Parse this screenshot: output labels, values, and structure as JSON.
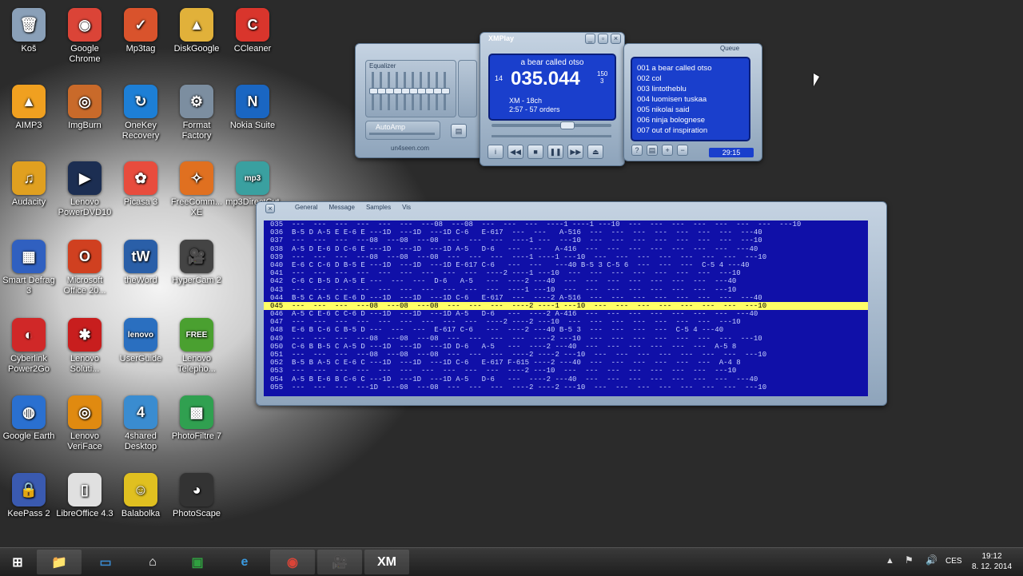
{
  "desktop": {
    "icons": [
      {
        "label": "Koš",
        "glyph": "🗑",
        "color": "#8aa0b8"
      },
      {
        "label": "Google Chrome",
        "glyph": "◉",
        "color": "#db4437"
      },
      {
        "label": "Mp3tag",
        "glyph": "✓",
        "color": "#d9532c"
      },
      {
        "label": "DiskGoogle",
        "glyph": "▲",
        "color": "#e1b13a"
      },
      {
        "label": "CCleaner",
        "glyph": "C",
        "color": "#d9352c"
      },
      {
        "label": "AIMP3",
        "glyph": "▲",
        "color": "#f0a020"
      },
      {
        "label": "ImgBurn",
        "glyph": "◎",
        "color": "#c96a2a"
      },
      {
        "label": "OneKey Recovery",
        "glyph": "↻",
        "color": "#1d7fd6"
      },
      {
        "label": "Format Factory",
        "glyph": "⚙",
        "color": "#7c8ea0"
      },
      {
        "label": "Nokia Suite",
        "glyph": "N",
        "color": "#1a66c2"
      },
      {
        "label": "Audacity",
        "glyph": "♫",
        "color": "#e0a020"
      },
      {
        "label": "Lenovo PowerDVD10",
        "glyph": "▶",
        "color": "#1c2e52"
      },
      {
        "label": "Picasa 3",
        "glyph": "✿",
        "color": "#e84c3d"
      },
      {
        "label": "FreeComm... XE",
        "glyph": "✧",
        "color": "#e07020"
      },
      {
        "label": "mp3DirectCut",
        "glyph": "mp3",
        "color": "#3aa0a0"
      },
      {
        "label": "Smart Defrag 3",
        "glyph": "▦",
        "color": "#3060c0"
      },
      {
        "label": "Microsoft Office 20...",
        "glyph": "O",
        "color": "#d04020"
      },
      {
        "label": "theWord",
        "glyph": "tW",
        "color": "#2a5fa8"
      },
      {
        "label": "HyperCam 2",
        "glyph": "🎥",
        "color": "#444444"
      },
      {
        "label": "Cyberlink Power2Go",
        "glyph": "◐",
        "color": "#d02828"
      },
      {
        "label": "Lenovo Soluti...",
        "glyph": "✱",
        "color": "#c81e1e"
      },
      {
        "label": "UserGuide",
        "glyph": "lenovo",
        "color": "#2a6fc0"
      },
      {
        "label": "Lenovo Telepho...",
        "glyph": "FREE",
        "color": "#4aa030"
      },
      {
        "label": "Google Earth",
        "glyph": "◍",
        "color": "#2a70d0"
      },
      {
        "label": "Lenovo VeriFace",
        "glyph": "◎",
        "color": "#e08a10"
      },
      {
        "label": "4shared Desktop",
        "glyph": "4",
        "color": "#3a8cd0"
      },
      {
        "label": "PhotoFiltre 7",
        "glyph": "▩",
        "color": "#30a050"
      },
      {
        "label": "KeePass 2",
        "glyph": "🔒",
        "color": "#3a5ab0"
      },
      {
        "label": "LibreOffice 4.3",
        "glyph": "▯",
        "color": "#e0e0e0"
      },
      {
        "label": "Balabolka",
        "glyph": "☺",
        "color": "#e0c020"
      },
      {
        "label": "PhotoScape",
        "glyph": "◕",
        "color": "#333333"
      }
    ]
  },
  "xmplay": {
    "equalizer_label": "Equalizer",
    "autoamp_label": "AutoAmp",
    "site": "un4seen.com",
    "title_bar": "XMPlay",
    "track_title": "a bear called otso",
    "left_num": "14",
    "time": "035.044",
    "right_top": "150",
    "right_bottom": "3",
    "format": "XM - 18ch",
    "duration": "2:57 - 57 orders",
    "queue_label": "Queue",
    "queue_total": "29:15",
    "queue": [
      "001 a bear called otso",
      "002 col",
      "003 lintotheblu",
      "004 luomisen tuskaa",
      "005 nikolai said",
      "006 ninja bolognese",
      "007 out of inspiration"
    ],
    "tabs": [
      "General",
      "Message",
      "Samples",
      "Vis"
    ],
    "pattern_rows": [
      "035  ---  ---  ---  ---  ---  ---  ---08  ---08  ---  ---  ---  ----1 ----1 ---10  ---  ---  ---  ---  ---  ---  ---  ---10",
      "036  B-5 D A-5 E E-6 E ---1D  ---1D  ---1D C-6   E-617  ---  ---   A-516  ---  ---  ---  ---  ---  ---  ---  ---40",
      "037  ---  ---  ---  ---08  ---08  ---08  ---  ---  ---  ----1 ---  ---10  ---  ---  ---  ---  ---  ---  ---  ---10",
      "038  A-5 D E-6 D C-6 E ---1D  ---1D  ---1D A-5   D-6   ---  ---   A-416  ---  ---  ---  ---  ---  ---  ---  ---40",
      "039  ---  ---  ---  ---08  ---08  ---08  ---  ---  ---  ----1 ----1 ---10  ---  ---  ---  ---  ---  ---  ---  ---10",
      "040  E-6 C C-6 D B-5 E ---1D  ---1D  ---1D E-617 C-6   ---  ---   ---40 B-5 3 C-5 6  ---  ---  ---  C-5 4 ---40",
      "041  ---  ---  ---  ---  ---  ---  ---  ---  ---  ----2 ----1 ---10  ---  ---  ---  ---  ---  ---  ---  ---10",
      "042  C-6 C B-5 D A-5 E ---  ---  ---  D-6   A-5   ---  ----2 ---40  ---  ---  ---  ---  ---  ---  ---  ---40",
      "043  ---  ---  ---  ---  ---  ---  ---  ---  ---  ---  ----1 ---10  ---  ---  ---  ---  ---  ---  ---  ---10",
      "044  B-5 C A-5 C E-6 D ---1D  ---1D  ---1D C-6   E-617  ---  ----2 A-516  ---  ---  ---  ---  ---  ---  ---  ---40",
      "045  ---  ---  ---  ---08  ---08  ---08  ---  ---  ---  ----2 ----1 ---10  ---  ---  ---  ---  ---  ---  ---  ---10",
      "046  A-5 C E-6 C C-6 D ---1D  ---1D  ---1D A-5   D-6   ---  ----2 A-416  ---  ---  ---  ---  ---  ---  ---  ---40",
      "047  ---  ---  ---  ---  ---  ---  ---  ---  ---  ----2 ----2 ---10  ---  ---  ---  ---  ---  ---  ---  ---10",
      "048  E-6 B C-6 C B-5 D ---  ---  ---  E-617 C-6   ---  ----2 ---40 B-5 3  ---  ---  ---  ---  C-5 4 ---40",
      "049  ---  ---  ---  ---08  ---08  ---08  ---  ---  ---  ---  ----2 ---10  ---  ---  ---  ---  ---  ---  ---  ---10",
      "050  C-6 B B-5 C A-5 D ---1D  ---1D  ---1D D-6   A-5   ---  ----2 ---40  ---  ---  ---  ---  ---  ---  A-5 8",
      "051  ---  ---  ---  ---08  ---08  ---08  ---  ---  ---  ----2 ----2 ---10  ---  ---  ---  ---  ---  ---  ---  ---10",
      "052  B-5 B A-5 C E-6 C ---1D  ---1D  ---1D C-6   E-617 F-615 ----2 ---40  ---  ---  ---  ---  ---  ---  A-4 8",
      "053  ---  ---  ---  ---  ---  ---  ---  ---  ---  ---  ----2 ---10  ---  ---  ---  ---  ---  ---  ---  ---10",
      "054  A-5 B E-6 B C-6 C ---1D  ---1D  ---1D A-5   D-6   ---  ----2 ---40  ---  ---  ---  ---  ---  ---  ---  ---40",
      "055  ---  ---  ---  ---1D  ---08  ---08  ---  ---  ---  ----2 ----2 ---10  ---  ---  ---  ---  ---  ---  ---  ---10"
    ],
    "active_row_index": 10
  },
  "taskbar": {
    "items": [
      {
        "name": "start-button",
        "glyph": "⊞",
        "color": "#ffffff",
        "run": false
      },
      {
        "name": "taskbar-explorer",
        "glyph": "📁",
        "color": "#e8c050",
        "run": true
      },
      {
        "name": "taskbar-lenovo",
        "glyph": "▭",
        "color": "#3a8ad0",
        "run": false
      },
      {
        "name": "taskbar-home",
        "glyph": "⌂",
        "color": "#ffffff",
        "run": false
      },
      {
        "name": "taskbar-store",
        "glyph": "▣",
        "color": "#30a040",
        "run": false
      },
      {
        "name": "taskbar-ie",
        "glyph": "e",
        "color": "#3a9ae0",
        "run": false
      },
      {
        "name": "taskbar-chrome",
        "glyph": "◉",
        "color": "#db4437",
        "run": true
      },
      {
        "name": "taskbar-hypercam",
        "glyph": "🎥",
        "color": "#cccccc",
        "run": true
      },
      {
        "name": "taskbar-xmplay",
        "glyph": "XM",
        "color": "#ffffff",
        "run": true
      }
    ],
    "language": "CES",
    "time": "19:12",
    "date": "8. 12. 2014"
  }
}
